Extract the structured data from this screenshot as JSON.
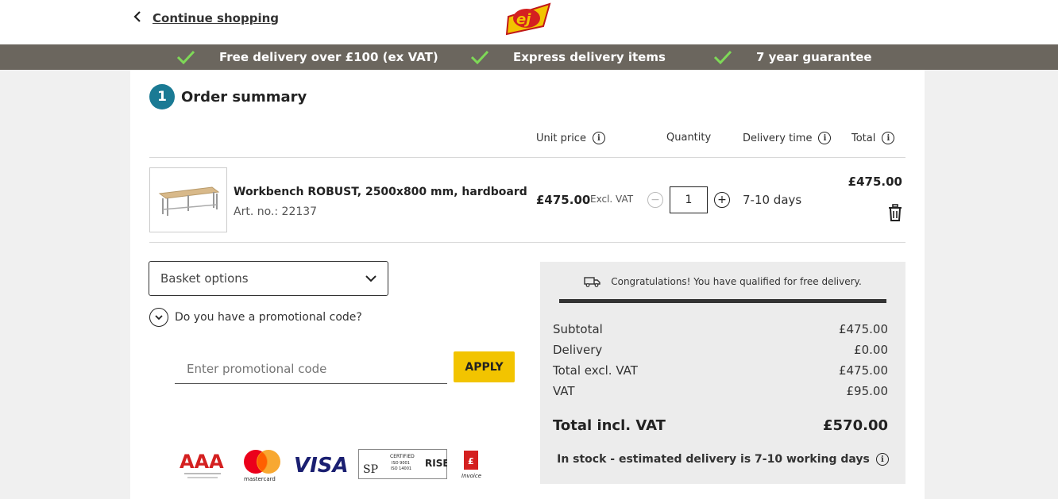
{
  "header": {
    "continue_label": "Continue shopping",
    "logo_text": "ej"
  },
  "usp": [
    {
      "label": "Free delivery over £100 (ex VAT)"
    },
    {
      "label": "Express delivery items"
    },
    {
      "label": "7 year guarantee"
    }
  ],
  "order": {
    "step_number": "1",
    "title": "Order summary",
    "columns": {
      "unit_price": "Unit price",
      "quantity": "Quantity",
      "delivery_time": "Delivery time",
      "total": "Total"
    },
    "item": {
      "name": "Workbench ROBUST, 2500x800 mm, hardboard",
      "art_no": "Art. no.: 22137",
      "unit_price": "£475.00",
      "vat_note": "Excl. VAT",
      "quantity": "1",
      "delivery": "7-10 days",
      "total": "£475.00"
    }
  },
  "basket": {
    "options_label": "Basket options",
    "promo_question": "Do you have a promotional code?",
    "promo_placeholder": "Enter promotional code",
    "apply_label": "APPLY"
  },
  "summary": {
    "congrats": "Congratulations! You have qualified for free delivery.",
    "rows": [
      {
        "label": "Subtotal",
        "value": "£475.00"
      },
      {
        "label": "Delivery",
        "value": "£0.00"
      },
      {
        "label": "Total excl. VAT",
        "value": "£475.00"
      },
      {
        "label": "VAT",
        "value": "£95.00"
      }
    ],
    "total_label": "Total incl. VAT",
    "total_value": "£570.00",
    "stock_note": "In stock - estimated delivery is 7-10 working days"
  },
  "payment_logos": {
    "aaa": "AAA",
    "mastercard": "mastercard",
    "visa": "VISA",
    "sp": "SP",
    "certified": "CERTIFIED",
    "iso9001": "ISO 9001",
    "iso14001": "ISO 14001",
    "rise": "RISE",
    "invoice": "Invoice"
  },
  "colors": {
    "usp_bar": "#6b665e",
    "step_badge": "#1a7a94",
    "apply_button": "#f2c400",
    "check": "#7ed957"
  }
}
